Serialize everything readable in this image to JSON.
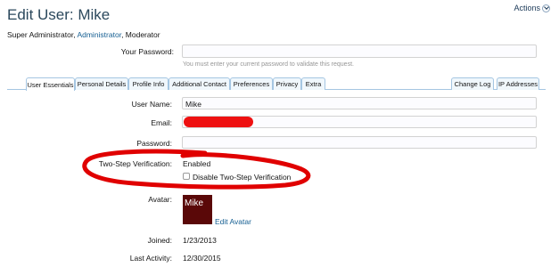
{
  "header": {
    "title": "Edit User: Mike",
    "actions_label": "Actions"
  },
  "user_groups": {
    "primary": "Super Administrator",
    "secondary_link": "Administrator",
    "tertiary": "Moderator"
  },
  "your_password": {
    "label": "Your Password:",
    "value": "",
    "explain": "You must enter your current password to validate this request."
  },
  "tabs": {
    "left": [
      "User Essentials",
      "Personal Details",
      "Profile Info",
      "Additional Contact",
      "Preferences",
      "Privacy",
      "Extra"
    ],
    "right": [
      "Change Log",
      "IP Addresses"
    ],
    "active": "User Essentials"
  },
  "form": {
    "username": {
      "label": "User Name:",
      "value": "Mike"
    },
    "email": {
      "label": "Email:"
    },
    "password": {
      "label": "Password:",
      "value": ""
    },
    "two_step": {
      "label": "Two-Step Verification:",
      "status": "Enabled",
      "disable_label": "Disable Two-Step Verification",
      "disable_checked": false
    },
    "avatar": {
      "label": "Avatar:",
      "image_text": "Mike",
      "edit_label": "Edit Avatar"
    },
    "joined": {
      "label": "Joined:",
      "value": "1/23/2013"
    },
    "last_activity": {
      "label": "Last Activity:",
      "value": "12/30/2015"
    }
  },
  "annotation": {
    "color": "#e00000"
  },
  "redaction": {
    "color": "#ee1111"
  }
}
